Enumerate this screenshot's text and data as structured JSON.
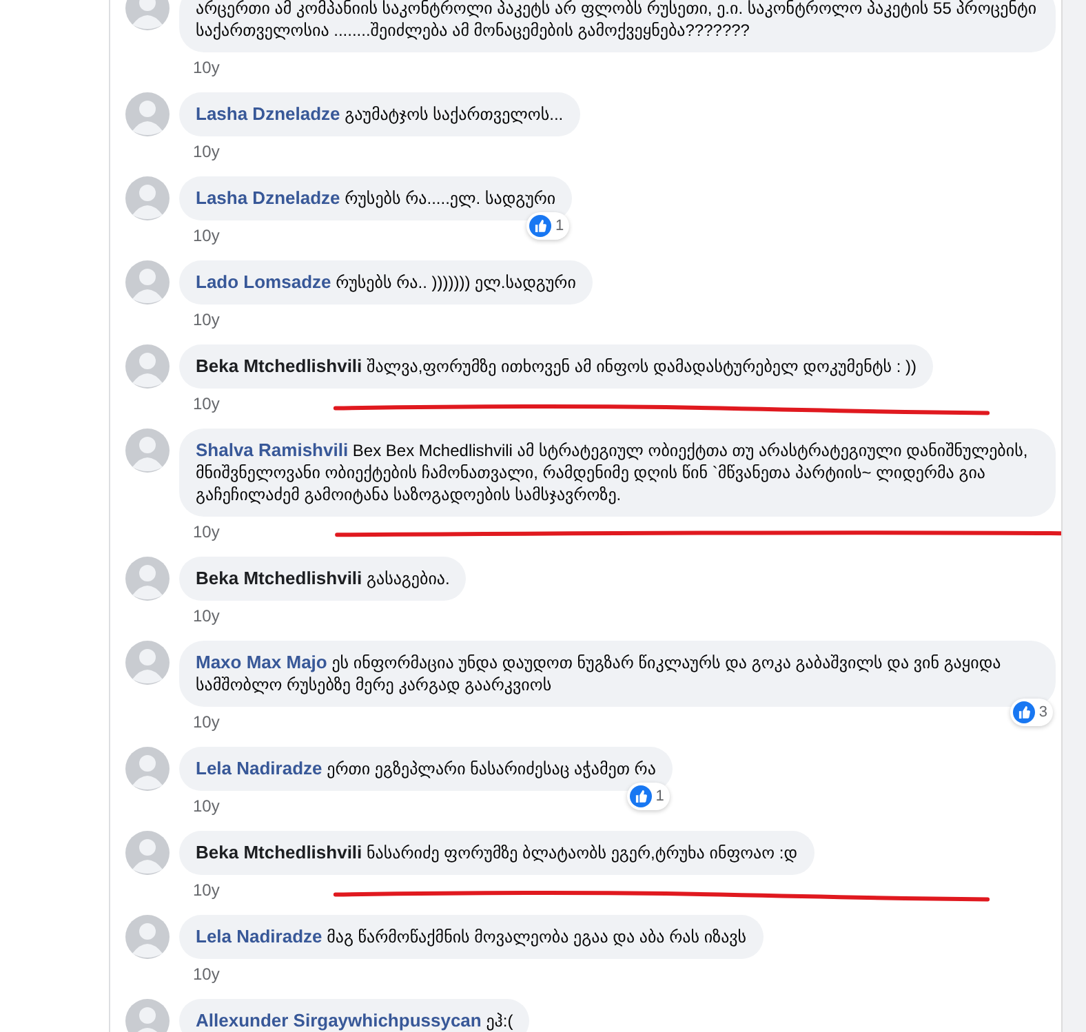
{
  "comments": [
    {
      "text": "არცერთი ამ კომპანიის საკონტროლი პაკეტს არ ფლობს რუსეთი, ე.ი. საკონტროლო პაკეტის 55 პროცენტი საქართველოსია ........შეიძლება ამ მონაცემების გამოქვეყნება???????",
      "time": "10y",
      "underlined": false
    },
    {
      "author": "Lasha Dzneladze",
      "text": "გაუმატჯოს საქართველოს...",
      "time": "10y",
      "is_page_author": false,
      "underlined": false
    },
    {
      "author": "Lasha Dzneladze",
      "text": "რუსებს რა.....ელ. სადგური",
      "time": "10y",
      "likes": "1",
      "is_page_author": false,
      "underlined": false
    },
    {
      "author": "Lado Lomsadze",
      "text": "რუსებს რა.. ))))))) ელ.სადგური",
      "time": "10y",
      "is_page_author": false,
      "underlined": false
    },
    {
      "author": "Beka Mtchedlishvili",
      "text": "შალვა,ფორუმზე ითხოვენ ამ ინფოს დამადასტურებელ დოკუმენტს : ))",
      "time": "10y",
      "is_page_author": true,
      "underlined": true
    },
    {
      "author": "Shalva Ramishvili",
      "text": "Bex Bex Mchedlishvili ამ სტრატეგიულ ობიექტთა თუ არასტრატეგიული დანიშნულების, მნიშვნელოვანი ობიექტების ჩამონათვალი, რამდენიმე დღის წინ `მწვანეთა პარტიის~ ლიდერმა გია გაჩეჩილაძემ გამოიტანა საზოგადოების სამსჯავროზე.",
      "time": "10y",
      "is_page_author": false,
      "underlined": true
    },
    {
      "author": "Beka Mtchedlishvili",
      "text": "გასაგებია.",
      "time": "10y",
      "is_page_author": true,
      "underlined": false
    },
    {
      "author": "Maxo Max Majo",
      "text": "ეს ინფორმაცია უნდა დაუდოთ ნუგზარ წიკლაურს და გოკა გაბაშვილს და ვინ გაყიდა სამშობლო რუსებზე მერე კარგად გაარკვიოს",
      "time": "10y",
      "likes": "3",
      "is_page_author": false,
      "underlined": false
    },
    {
      "author": "Lela Nadiradze",
      "text": "ერთი ეგზეპლარი ნასარიძესაც აჭამეთ რა",
      "time": "10y",
      "likes": "1",
      "is_page_author": false,
      "underlined": false
    },
    {
      "author": "Beka Mtchedlishvili",
      "text": "ნასარიძე ფორუმზე ბლატაობს ეგერ,ტრუხა ინფოაო :დ",
      "time": "10y",
      "is_page_author": true,
      "underlined": true
    },
    {
      "author": "Lela Nadiradze",
      "text": "მაგ წარმოწაქმნის მოვალეობა ეგაა და აბა რას იზავს",
      "time": "10y",
      "is_page_author": false,
      "underlined": false
    },
    {
      "author": "Allexunder Sirgaywhichpussycan",
      "text": "ეჰ:(",
      "is_page_author": false
    }
  ]
}
